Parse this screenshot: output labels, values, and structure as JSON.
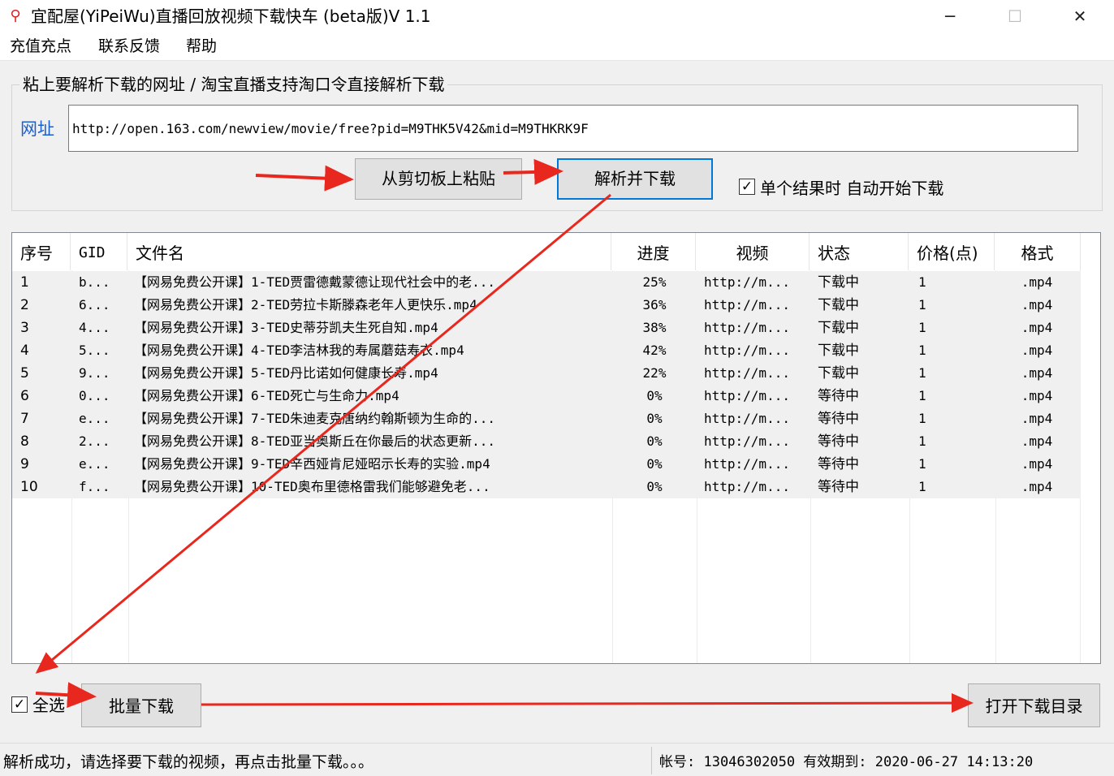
{
  "window": {
    "title": "宜配屋(YiPeiWu)直播回放视频下载快车 (beta版)V 1.1",
    "app_icon": "pin-icon",
    "minimize": "─",
    "maximize": "☐",
    "close": "✕"
  },
  "menu": {
    "items": [
      "充值充点",
      "联系反馈",
      "帮助"
    ]
  },
  "url_group": {
    "legend": "粘上要解析下载的网址 / 淘宝直播支持淘口令直接解析下载",
    "label": "网址",
    "value": "http://open.163.com/newview/movie/free?pid=M9THK5V42&mid=M9THKRK9F",
    "paste_button": "从剪切板上粘贴",
    "parse_button": "解析并下载",
    "auto_checkbox_checked": true,
    "auto_checkbox_label": "单个结果时 自动开始下载"
  },
  "list": {
    "columns": [
      "序号",
      "GID",
      "文件名",
      "进度",
      "视频",
      "状态",
      "价格(点)",
      "格式"
    ],
    "rows": [
      {
        "no": "1",
        "gid": "b...",
        "name": "【网易免费公开课】1-TED贾雷德戴蒙德让现代社会中的老...",
        "progress": "25%",
        "video": "http://m...",
        "status": "下载中",
        "price": "1",
        "format": ".mp4"
      },
      {
        "no": "2",
        "gid": "6...",
        "name": "【网易免费公开课】2-TED劳拉卡斯滕森老年人更快乐.mp4",
        "progress": "36%",
        "video": "http://m...",
        "status": "下载中",
        "price": "1",
        "format": ".mp4"
      },
      {
        "no": "3",
        "gid": "4...",
        "name": "【网易免费公开课】3-TED史蒂芬凯夫生死自知.mp4",
        "progress": "38%",
        "video": "http://m...",
        "status": "下载中",
        "price": "1",
        "format": ".mp4"
      },
      {
        "no": "4",
        "gid": "5...",
        "name": "【网易免费公开课】4-TED李洁林我的寿属蘑菇寿衣.mp4",
        "progress": "42%",
        "video": "http://m...",
        "status": "下载中",
        "price": "1",
        "format": ".mp4"
      },
      {
        "no": "5",
        "gid": "9...",
        "name": "【网易免费公开课】5-TED丹比诺如何健康长寿.mp4",
        "progress": "22%",
        "video": "http://m...",
        "status": "下载中",
        "price": "1",
        "format": ".mp4"
      },
      {
        "no": "6",
        "gid": "0...",
        "name": "【网易免费公开课】6-TED死亡与生命力.mp4",
        "progress": "0%",
        "video": "http://m...",
        "status": "等待中",
        "price": "1",
        "format": ".mp4"
      },
      {
        "no": "7",
        "gid": "e...",
        "name": "【网易免费公开课】7-TED朱迪麦克唐纳约翰斯顿为生命的...",
        "progress": "0%",
        "video": "http://m...",
        "status": "等待中",
        "price": "1",
        "format": ".mp4"
      },
      {
        "no": "8",
        "gid": "2...",
        "name": "【网易免费公开课】8-TED亚当奥斯丘在你最后的状态更新...",
        "progress": "0%",
        "video": "http://m...",
        "status": "等待中",
        "price": "1",
        "format": ".mp4"
      },
      {
        "no": "9",
        "gid": "e...",
        "name": "【网易免费公开课】9-TED辛西娅肯尼娅昭示长寿的实验.mp4",
        "progress": "0%",
        "video": "http://m...",
        "status": "等待中",
        "price": "1",
        "format": ".mp4"
      },
      {
        "no": "10",
        "gid": "f...",
        "name": "【网易免费公开课】10-TED奥布里德格雷我们能够避免老...",
        "progress": "0%",
        "video": "http://m...",
        "status": "等待中",
        "price": "1",
        "format": ".mp4"
      }
    ]
  },
  "bottom": {
    "select_all_checked": true,
    "select_all_label": "全选",
    "batch_button": "批量下载",
    "open_dir_button": "打开下载目录"
  },
  "status": {
    "message": "解析成功，请选择要下载的视频，再点击批量下载。。。",
    "account": "帐号: 13046302050 有效期到: 2020-06-27 14:13:20"
  },
  "colors": {
    "arrow": "#e8281e",
    "focus": "#0078d7",
    "label_blue": "#1a5fd0"
  }
}
